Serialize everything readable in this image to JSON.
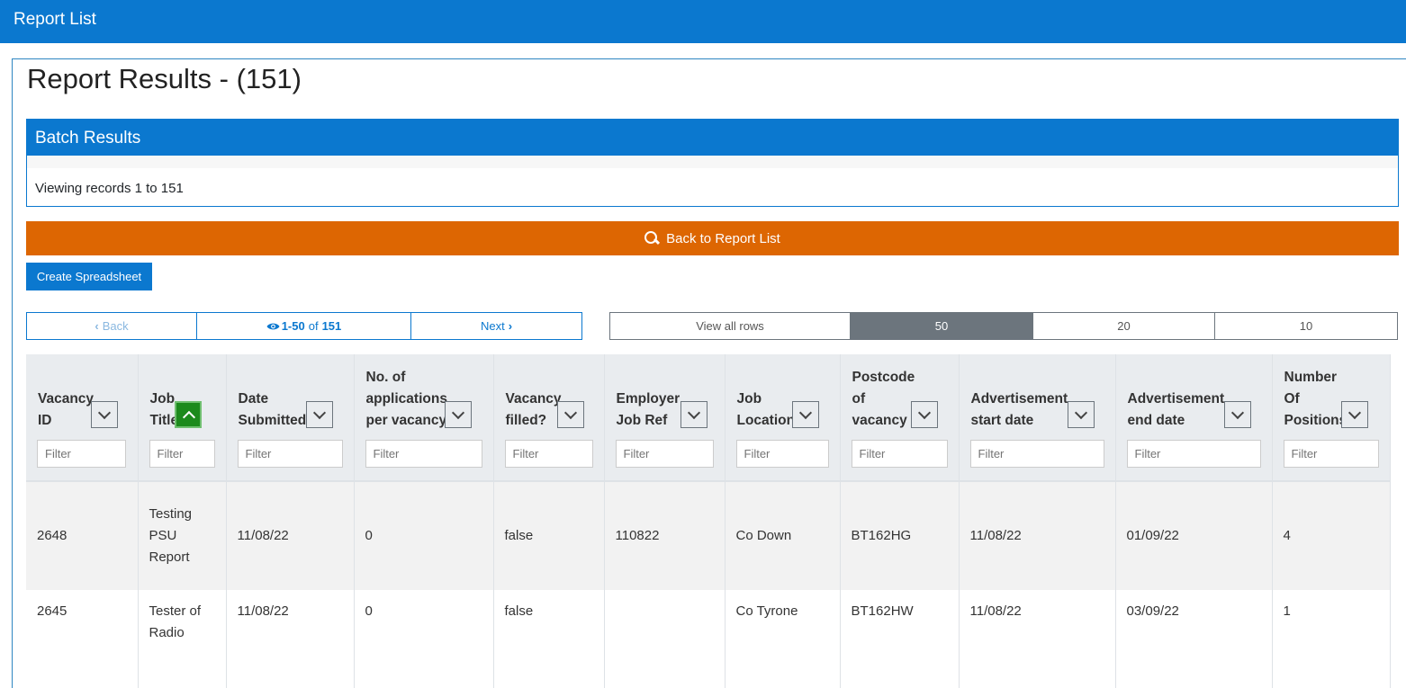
{
  "topbar": {
    "title": "Report List"
  },
  "page": {
    "title": "Report Results - (151)"
  },
  "batch": {
    "header": "Batch Results",
    "viewing": "Viewing records 1 to 151"
  },
  "actions": {
    "back_to_list": "Back to Report List",
    "create_spreadsheet": "Create Spreadsheet"
  },
  "pager": {
    "back": "Back",
    "range": "1-50",
    "of": "of",
    "total": "151",
    "next": "Next"
  },
  "rows_per_page": {
    "all": "View all rows",
    "options": [
      "50",
      "20",
      "10"
    ],
    "selected": "50"
  },
  "table": {
    "filter_placeholder": "Filter",
    "columns": [
      {
        "label": "Vacancy ID",
        "lines": [
          "Vacancy",
          "ID"
        ]
      },
      {
        "label": "Job Title",
        "lines": [
          "Job",
          "Title"
        ],
        "sorted": true
      },
      {
        "label": "Date Submitted",
        "lines": [
          "Date",
          "Submitted"
        ]
      },
      {
        "label": "No. of applications per vacancy",
        "lines": [
          "No. of",
          "applications",
          "per vacancy"
        ]
      },
      {
        "label": "Vacancy filled?",
        "lines": [
          "Vacancy",
          "filled?"
        ]
      },
      {
        "label": "Employer Job Ref",
        "lines": [
          "Employer",
          "Job Ref"
        ]
      },
      {
        "label": "Job Location",
        "lines": [
          "Job",
          "Location"
        ]
      },
      {
        "label": "Postcode of vacancy",
        "lines": [
          "Postcode",
          "of",
          "vacancy"
        ]
      },
      {
        "label": "Advertisement start date",
        "lines": [
          "Advertisement",
          "start date"
        ]
      },
      {
        "label": "Advertisement end date",
        "lines": [
          "Advertisement",
          "end date"
        ]
      },
      {
        "label": "Number Of Positions",
        "lines": [
          "Number",
          "Of",
          "Positions"
        ]
      }
    ],
    "rows": [
      {
        "cells": [
          "2648",
          "Testing PSU Report",
          "11/08/22",
          "0",
          "false",
          "110822",
          "Co Down",
          "BT162HG",
          "11/08/22",
          "01/09/22",
          "4"
        ],
        "job_title_lines": [
          "Testing",
          "PSU",
          "Report"
        ]
      },
      {
        "cells": [
          "2645",
          "Tester of Radio",
          "11/08/22",
          "0",
          "false",
          "",
          "Co Tyrone",
          "BT162HW",
          "11/08/22",
          "03/09/22",
          "1"
        ],
        "job_title_lines": [
          "Tester of",
          "Radio"
        ]
      }
    ]
  },
  "colors": {
    "primary": "#0b78cf",
    "orange": "#dd6602",
    "sort_active": "#1c8a1c",
    "header_bg": "#e9ecef"
  }
}
